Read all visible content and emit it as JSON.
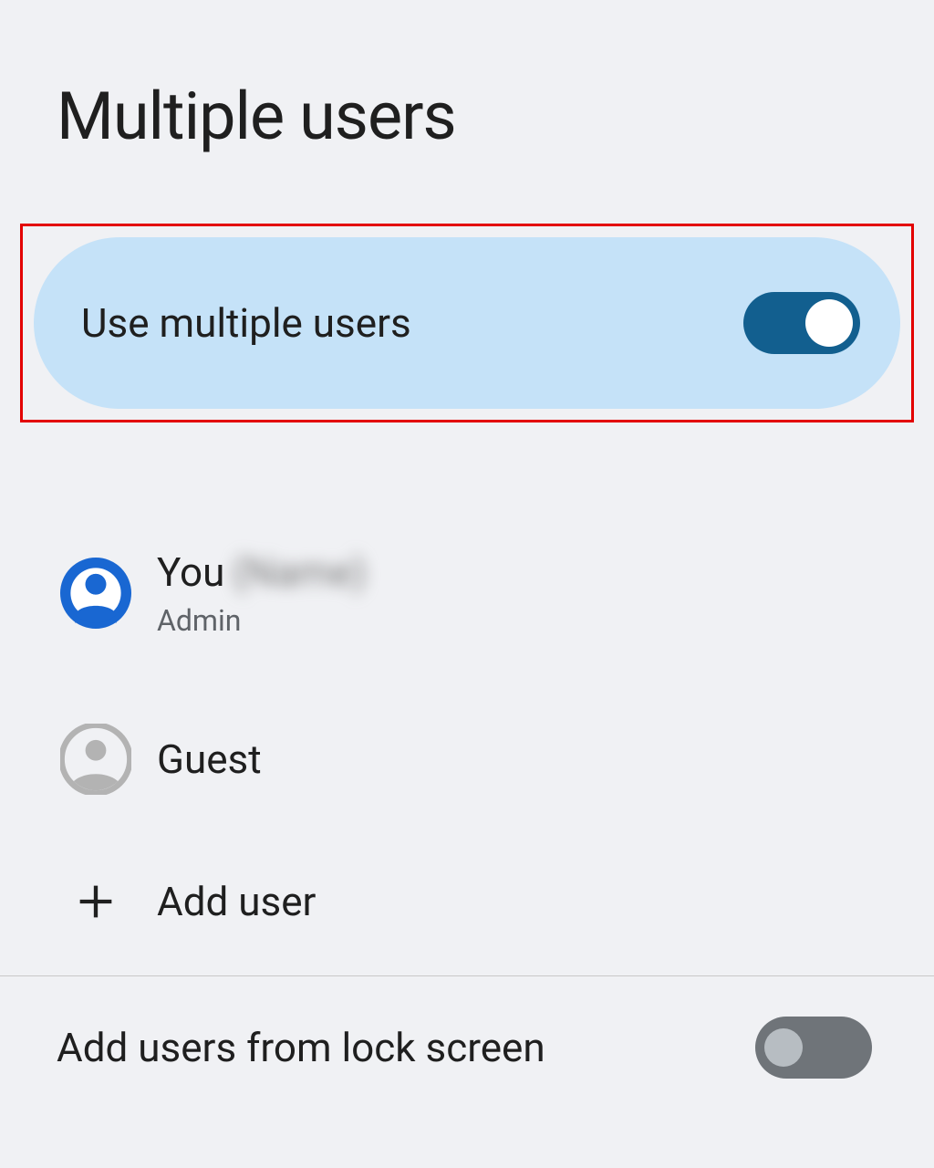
{
  "title": "Multiple users",
  "mainToggle": {
    "label": "Use multiple users",
    "state": "on"
  },
  "users": [
    {
      "label": "You",
      "nameRedacted": "(Name)",
      "sub": "Admin",
      "iconColor": "#1967d2"
    },
    {
      "label": "Guest",
      "sub": "",
      "iconColor": "#b3b3b3"
    }
  ],
  "addUser": {
    "label": "Add user"
  },
  "lockScreenToggle": {
    "label": "Add users from lock screen",
    "state": "off"
  }
}
